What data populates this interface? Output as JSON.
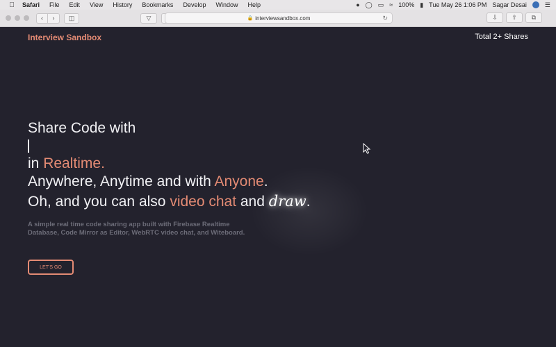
{
  "menubar": {
    "app": "Safari",
    "items": [
      "File",
      "Edit",
      "View",
      "History",
      "Bookmarks",
      "Develop",
      "Window",
      "Help"
    ],
    "battery": "100%",
    "clock": "Tue May 26  1:06 PM",
    "user": "Sagar Desai"
  },
  "browser": {
    "url": "interviewsandbox.com"
  },
  "site": {
    "brand": "Interview Sandbox",
    "shares": "Total 2+ Shares"
  },
  "hero": {
    "line1": "Share Code with",
    "line3_prefix": "in ",
    "line3_accent": "Realtime",
    "line3_suffix": ".",
    "line4_prefix": "Anywhere, Anytime and with ",
    "line4_accent": "Anyone",
    "line4_suffix": ".",
    "line5_prefix": "Oh, and you can also ",
    "line5_accent": "video chat",
    "line5_mid": " and ",
    "line5_draw": "draw",
    "line5_suffix": "."
  },
  "description": "A simple real time code sharing app built with Firebase Realtime Database, Code Mirror as Editor, WebRTC video chat, and Witeboard.",
  "cta": "LET'S GO",
  "colors": {
    "background": "#23222d",
    "accent": "#e48b74",
    "text": "#f1f1f4",
    "muted": "#6c6c78"
  }
}
